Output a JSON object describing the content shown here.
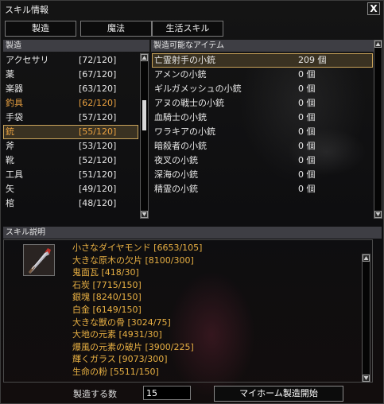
{
  "window": {
    "title": "スキル情報",
    "close_label": "X"
  },
  "tabs": [
    "製造",
    "魔法",
    "生活スキル"
  ],
  "left_panel": {
    "header": "製造",
    "items": [
      {
        "name": "アクセサリ",
        "level": "[72/120]",
        "style": "normal"
      },
      {
        "name": "薬",
        "level": "[67/120]",
        "style": "normal"
      },
      {
        "name": "楽器",
        "level": "[63/120]",
        "style": "normal"
      },
      {
        "name": "釣具",
        "level": "[62/120]",
        "style": "orange"
      },
      {
        "name": "手袋",
        "level": "[57/120]",
        "style": "normal"
      },
      {
        "name": "銃",
        "level": "[55/120]",
        "style": "selected"
      },
      {
        "name": "斧",
        "level": "[53/120]",
        "style": "normal"
      },
      {
        "name": "靴",
        "level": "[52/120]",
        "style": "normal"
      },
      {
        "name": "工具",
        "level": "[51/120]",
        "style": "normal"
      },
      {
        "name": "矢",
        "level": "[49/120]",
        "style": "normal"
      },
      {
        "name": "棺",
        "level": "[48/120]",
        "style": "normal"
      }
    ]
  },
  "right_panel": {
    "header": "製造可能なアイテム",
    "items": [
      {
        "name": "亡霊射手の小銃",
        "count": "209 個",
        "selected": true
      },
      {
        "name": "アメンの小銃",
        "count": "0 個"
      },
      {
        "name": "ギルガメッシュの小銃",
        "count": "0 個"
      },
      {
        "name": "アヌの戦士の小銃",
        "count": "0 個"
      },
      {
        "name": "血騎士の小銃",
        "count": "0 個"
      },
      {
        "name": "ワラキアの小銃",
        "count": "0 個"
      },
      {
        "name": "暗殺者の小銃",
        "count": "0 個"
      },
      {
        "name": "夜叉の小銃",
        "count": "0 個"
      },
      {
        "name": "深海の小銃",
        "count": "0 個"
      },
      {
        "name": "精霊の小銃",
        "count": "0 個"
      }
    ]
  },
  "description": {
    "header": "スキル説明",
    "icon": "rifle-icon",
    "materials": [
      "小さなダイヤモンド [6653/105]",
      "大きな原木の欠片 [8100/300]",
      "鬼面瓦 [418/30]",
      "石炭 [7715/150]",
      "銀塊 [8240/150]",
      "白金 [6149/150]",
      "大きな獣の骨 [3024/75]",
      "大地の元素 [4931/30]",
      "爆風の元素の破片 [3900/225]",
      "輝くガラス [9073/300]",
      "生命の粉 [5511/150]"
    ]
  },
  "footer": {
    "quantity_label": "製造する数",
    "quantity_value": "15",
    "start_button": "マイホーム製造開始"
  },
  "colors": {
    "highlight": "#e8a040",
    "material_text": "#e8b043",
    "selection_border": "#c9a35a"
  }
}
